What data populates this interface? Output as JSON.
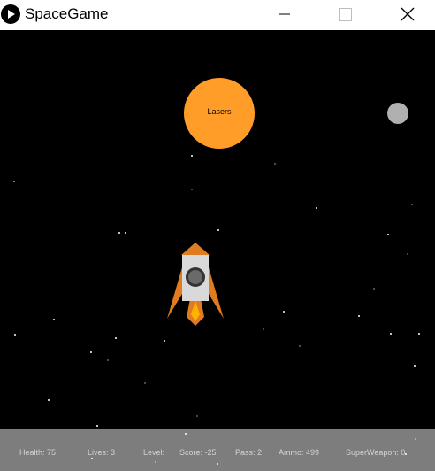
{
  "window": {
    "title": "SpaceGame",
    "app_icon": "play-icon",
    "controls": [
      "minimize-icon",
      "maximize-icon",
      "close-icon"
    ]
  },
  "game": {
    "planet": {
      "label": "Lasers",
      "color": "#ff9d28"
    },
    "moon": {
      "color": "#b0b0b0"
    },
    "background_color": "#000000",
    "rocket": {
      "body_color": "#d9d9d9",
      "fin_color": "#e07b1f",
      "flame_color": "#ffb300",
      "window_color": "#555555"
    }
  },
  "hud": {
    "background_color": "#7d7d7d",
    "text_color": "#d4d4d4",
    "health": "Health: 75",
    "lives": "Lives: 3",
    "level": "Level:",
    "score": "Score: -25",
    "pass": "Pass: 2",
    "ammo": "Ammo: 499",
    "superweapon": "SuperWeapon: 0"
  }
}
